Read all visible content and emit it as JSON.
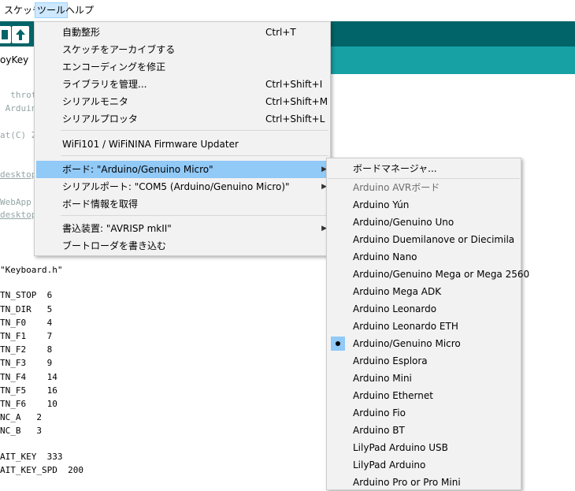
{
  "menubar": {
    "items": [
      {
        "label": "スケッチ"
      },
      {
        "label": "ツール"
      },
      {
        "label": "ヘルプ"
      }
    ]
  },
  "tab": {
    "label": "oyKey"
  },
  "code_lines": [
    "  throt",
    " Arduin",
    "",
    "at(C) 2",
    "",
    "desktop",
    "",
    "WebApp",
    "desktop",
    "",
    "",
    "",
    "\"Keyboard.h\"",
    "",
    "TN_STOP  6",
    "TN_DIR   5",
    "TN_F0    4",
    "TN_F1    7",
    "TN_F2    8",
    "TN_F3    9",
    "TN_F4    14",
    "TN_F5    16",
    "TN_F6    10",
    "NC_A   2",
    "NC_B   3",
    "",
    "AIT_KEY  333",
    "AIT_KEY_SPD  200"
  ],
  "tools_menu": {
    "items": [
      {
        "label": "自動整形",
        "shortcut": "Ctrl+T"
      },
      {
        "label": "スケッチをアーカイブする",
        "shortcut": ""
      },
      {
        "label": "エンコーディングを修正",
        "shortcut": ""
      },
      {
        "label": "ライブラリを管理...",
        "shortcut": "Ctrl+Shift+I"
      },
      {
        "label": "シリアルモニタ",
        "shortcut": "Ctrl+Shift+M"
      },
      {
        "label": "シリアルプロッタ",
        "shortcut": "Ctrl+Shift+L"
      },
      {
        "label": "WiFi101 / WiFiNINA Firmware Updater",
        "shortcut": ""
      },
      {
        "label": "ボード: \"Arduino/Genuino Micro\"",
        "shortcut": ""
      },
      {
        "label": "シリアルポート: \"COM5 (Arduino/Genuino Micro)\"",
        "shortcut": ""
      },
      {
        "label": "ボード情報を取得",
        "shortcut": ""
      },
      {
        "label": "書込装置: \"AVRISP mkII\"",
        "shortcut": ""
      },
      {
        "label": "ブートローダを書き込む",
        "shortcut": ""
      }
    ]
  },
  "board_menu": {
    "items": [
      {
        "label": "ボードマネージャ..."
      },
      {
        "label": "Arduino AVRボード"
      },
      {
        "label": "Arduino Yún"
      },
      {
        "label": "Arduino/Genuino Uno"
      },
      {
        "label": "Arduino Duemilanove or Diecimila"
      },
      {
        "label": "Arduino Nano"
      },
      {
        "label": "Arduino/Genuino Mega or Mega 2560"
      },
      {
        "label": "Arduino Mega ADK"
      },
      {
        "label": "Arduino Leonardo"
      },
      {
        "label": "Arduino Leonardo ETH"
      },
      {
        "label": "Arduino/Genuino Micro"
      },
      {
        "label": "Arduino Esplora"
      },
      {
        "label": "Arduino Mini"
      },
      {
        "label": "Arduino Ethernet"
      },
      {
        "label": "Arduino Fio"
      },
      {
        "label": "Arduino BT"
      },
      {
        "label": "LilyPad Arduino USB"
      },
      {
        "label": "LilyPad Arduino"
      },
      {
        "label": "Arduino Pro or Pro Mini"
      }
    ]
  }
}
